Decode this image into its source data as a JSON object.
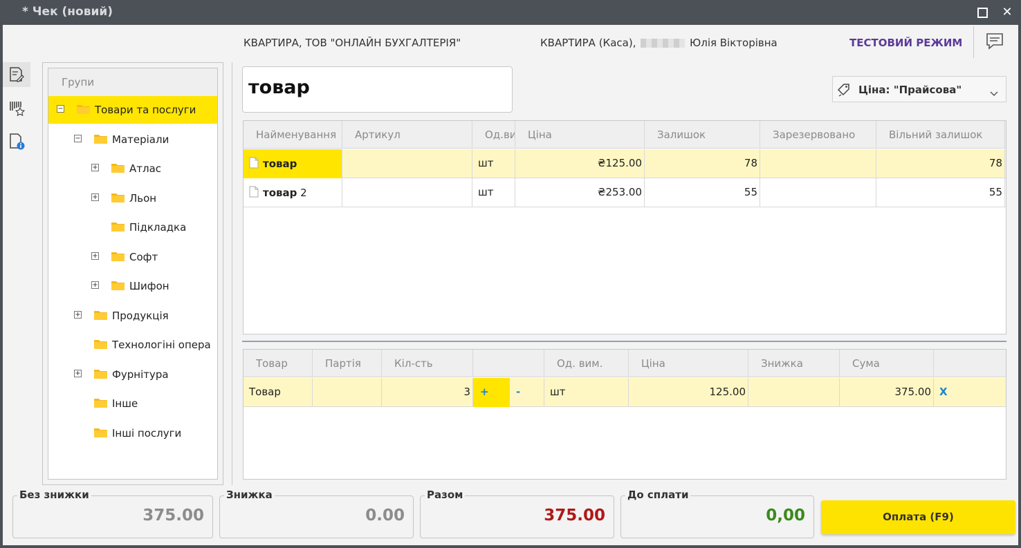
{
  "window": {
    "title": "* Чек (новий)"
  },
  "header": {
    "company": "КВАРТИРА, ТОВ \"ОНЛАЙН БУХГАЛТЕРІЯ\"",
    "cash_prefix": "КВАРТИРА (Каса),",
    "cashier": "Юлія Вікторівна",
    "mode": "ТЕСТОВИЙ РЕЖИМ"
  },
  "groups": {
    "header": "Групи",
    "items": [
      {
        "label": "Товари та послуги",
        "expander": "⊟",
        "level": 0,
        "selected": true
      },
      {
        "label": "Матеріали",
        "expander": "⊟",
        "level": 1
      },
      {
        "label": "Атлас",
        "expander": "⊞",
        "level": 2
      },
      {
        "label": "Льон",
        "expander": "⊞",
        "level": 2
      },
      {
        "label": "Підкладка",
        "expander": "",
        "level": 2
      },
      {
        "label": "Софт",
        "expander": "⊞",
        "level": 2
      },
      {
        "label": "Шифон",
        "expander": "⊞",
        "level": 2
      },
      {
        "label": "Продукція",
        "expander": "⊞",
        "level": 1
      },
      {
        "label": "Технологіні опера",
        "expander": "",
        "level": 1
      },
      {
        "label": "Фурнітура",
        "expander": "⊞",
        "level": 1
      },
      {
        "label": "Інше",
        "expander": "",
        "level": 1
      },
      {
        "label": "Інші послуги",
        "expander": "",
        "level": 1
      }
    ]
  },
  "search": {
    "value": "товар"
  },
  "price_type": {
    "label": "Ціна: \"Прайсова\""
  },
  "products": {
    "columns": [
      "Найменування",
      "Артикул",
      "Од.вим.",
      "Ціна",
      "Залишок",
      "Зарезервовано",
      "Вільний залишок"
    ],
    "rows": [
      {
        "name_bold": "товар",
        "name_rest": "",
        "article": "",
        "unit": "шт",
        "price": "₴125.00",
        "stock": "78",
        "reserved": "",
        "free": "78"
      },
      {
        "name_bold": "товар",
        "name_rest": " 2",
        "article": "",
        "unit": "шт",
        "price": "₴253.00",
        "stock": "55",
        "reserved": "",
        "free": "55"
      }
    ]
  },
  "receipt": {
    "columns": [
      "Товар",
      "Партія",
      "Кіл-сть",
      "",
      "Од. вим.",
      "Ціна",
      "Знижка",
      "Сума",
      ""
    ],
    "rows": [
      {
        "product": "Товар",
        "batch": "",
        "qty": "3",
        "plus": "+",
        "minus": "-",
        "unit": "шт",
        "price": "125.00",
        "discount": "",
        "sum": "375.00",
        "remove": "X"
      }
    ]
  },
  "totals": {
    "no_discount_label": "Без знижки",
    "no_discount_value": "375.00",
    "discount_label": "Знижка",
    "discount_value": "0.00",
    "total_label": "Разом",
    "total_value": "375.00",
    "to_pay_label": "До сплати",
    "to_pay_value": "0,00"
  },
  "pay_button": "Оплата (F9)",
  "colors": {
    "accent": "#ffe500",
    "mode": "#5b3a99",
    "total": "#b01818",
    "to_pay": "#3b8a1c",
    "muted": "#8c8c8c"
  }
}
